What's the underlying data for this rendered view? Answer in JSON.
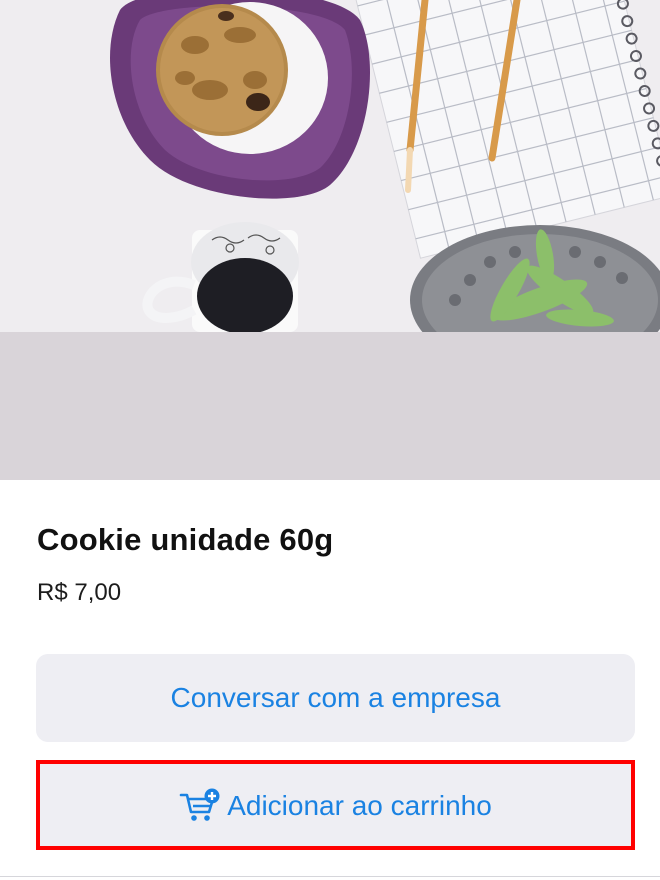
{
  "product": {
    "image_alt": "Cookie on purple plate with coffee mug, notebook, pencils and succulent",
    "title": "Cookie unidade 60g",
    "price": "R$ 7,00"
  },
  "actions": {
    "chat_label": "Conversar com a empresa",
    "cart_label": "Adicionar ao carrinho",
    "cart_icon": "cart-plus-icon"
  },
  "colors": {
    "accent": "#1a82e2",
    "button_bg": "#eeeef3",
    "highlight": "#ff0000"
  }
}
